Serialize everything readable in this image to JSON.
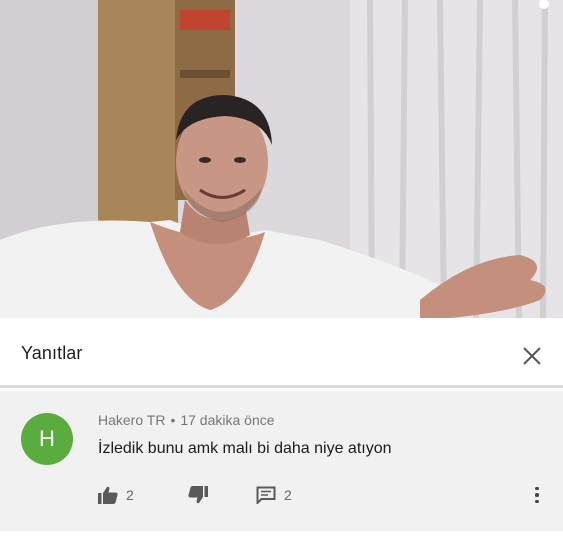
{
  "video": {
    "description_icon": "video-frame",
    "colors": {
      "wall": "#d9d6da",
      "shirt": "#f3f3f3",
      "skin": "#c58f7e",
      "curtain": "#e8e6e8",
      "shelf": "#a8865a"
    }
  },
  "replies_header": {
    "title": "Yanıtlar",
    "close_icon": "close-icon"
  },
  "comment": {
    "avatar_letter": "H",
    "avatar_color": "#5aac3f",
    "author": "Hakero TR",
    "separator": "•",
    "time": "17 dakika önce",
    "text": "İzledik bunu amk malı bi daha niye atıyon",
    "likes": "2",
    "replies": "2",
    "icons": {
      "like": "thumbs-up-icon",
      "dislike": "thumbs-down-icon",
      "reply": "comment-icon",
      "more": "more-vert-icon"
    }
  }
}
